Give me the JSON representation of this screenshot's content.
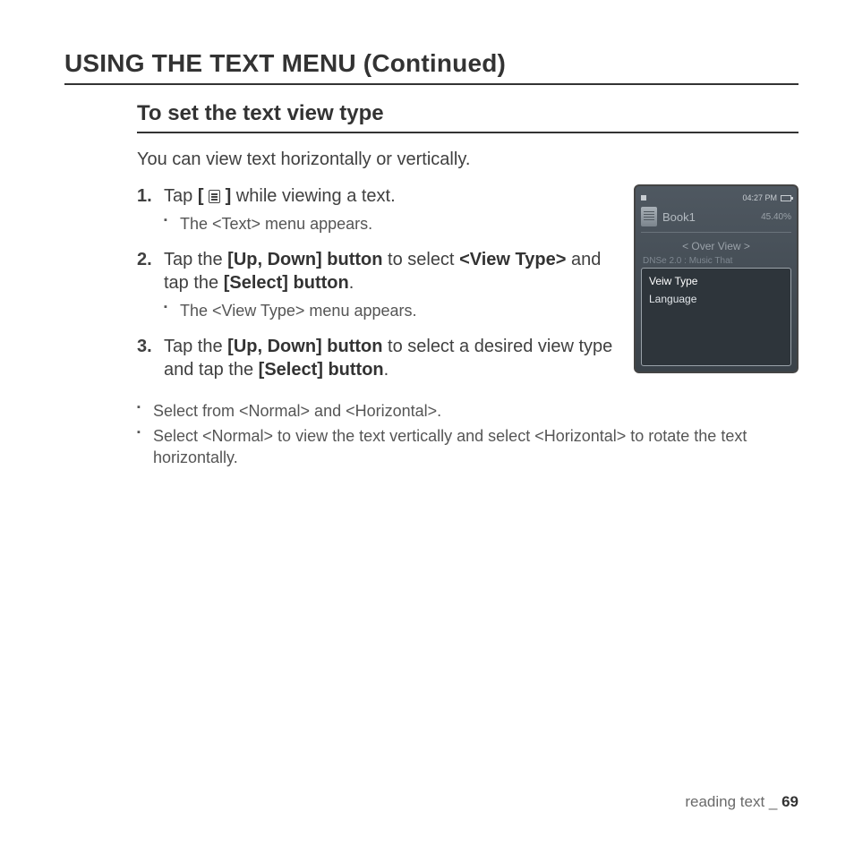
{
  "header": {
    "title": "USING THE TEXT MENU (Continued)"
  },
  "section": {
    "title": "To set the text view type",
    "intro": "You can view text horizontally or vertically."
  },
  "steps": {
    "s1": {
      "pre": "Tap ",
      "bracket_open": "[ ",
      "bracket_close": " ]",
      "post": " while viewing a text.",
      "sub1": "The <Text> menu appears."
    },
    "s2": {
      "t1": "Tap the ",
      "b1": "[Up, Down] button",
      "t2": " to select ",
      "b2": "<View Type>",
      "t3": " and tap the ",
      "b3": "[Select] button",
      "t4": ".",
      "sub1": "The <View Type> menu appears."
    },
    "s3": {
      "t1": "Tap the ",
      "b1": "[Up, Down] button",
      "t2": " to select a desired view type and tap the ",
      "b2": "[Select] button",
      "t3": ".",
      "sub1": "Select from <Normal> and <Horizontal>.",
      "sub2": "Select <Normal> to view the text vertically and select <Horizontal> to rotate the text horizontally."
    }
  },
  "device": {
    "time": "04:27 PM",
    "title": "Book1",
    "percent": "45.40%",
    "subtitle": "< Over View >",
    "truncated": "DNSe 2.0 : Music That",
    "opt1": "Veiw Type",
    "opt2": "Language"
  },
  "footer": {
    "label": "reading text _ ",
    "page": "69"
  }
}
